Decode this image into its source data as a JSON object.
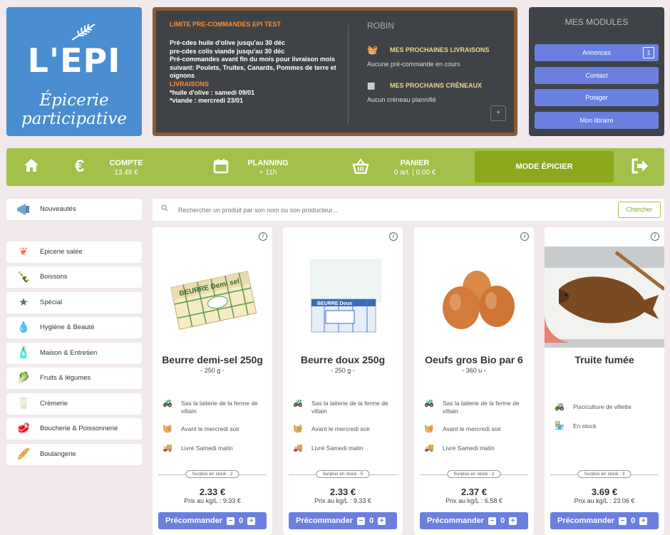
{
  "logo": {
    "title": "L'EPI",
    "subtitle_1": "Épicerie",
    "subtitle_2": "participative"
  },
  "board": {
    "left_title": "LIMITE PRE-COMMANDES EPI TEST",
    "lines": [
      "Pré-cdes huile d'olive jusqu'au 30 déc",
      "pre-cdes colis viande jusqu'au 30 déc",
      "Pré-commandes avant fin du mois pour livraison mois suivant: Poulets, Truites, Canards, Pommes de terre et oignons"
    ],
    "livraisons_label": "LIVRAISONS",
    "livraisons_lines": [
      "*huile d'olive : samedi 09/01",
      "*viande : mercredi 23/01"
    ],
    "user_name": "ROBIN",
    "deliveries_title": "MES PROCHAINES LIVRAISONS",
    "deliveries_text": "Aucune pré-commande en cours",
    "slots_title": "MES PROCHAINS CRÉNEAUX",
    "slots_text": "Aucun créneau plannifié",
    "plus_label": "+"
  },
  "modules": {
    "title": "MES MODULES",
    "items": [
      {
        "label": "Annonces",
        "badge": "1"
      },
      {
        "label": "Contact"
      },
      {
        "label": "Potager"
      },
      {
        "label": "Mon libraire"
      }
    ]
  },
  "nav": {
    "compte_label": "COMPTE",
    "compte_value": "13.48 €",
    "planning_label": "PLANNING",
    "planning_value": "+ 11h",
    "panier_label": "PANIER",
    "panier_value": "0 art. | 0.00 €",
    "mode_label": "MODE ÉPICIER"
  },
  "sidebar": {
    "top": "Nouveautés",
    "items": [
      "Epicerie salée",
      "Boissons",
      "Spécial",
      "Hygiène & Beauté",
      "Maison & Entretien",
      "Fruits & légumes",
      "Crèmerie",
      "Boucherie & Poissonnerie",
      "Boulangerie"
    ]
  },
  "search": {
    "placeholder": "Rechercher un produit par son nom ou son producteur...",
    "button": "Chercher"
  },
  "products": [
    {
      "name": "Beurre demi-sel 250g",
      "qty": "- 250 g -",
      "producer": "Sas la laiterie de la ferme de viltain",
      "availability": "Avant le mercredi soir",
      "delivery": "Livré Samedi matin",
      "stock": "Surplus en stock : 2",
      "price": "2.33 €",
      "kg": "Prix au kg/L : 9.33 €",
      "order": "Précommander",
      "count": "0",
      "box_text": "BEURRE Demi sel"
    },
    {
      "name": "Beurre doux 250g",
      "qty": "- 250 g -",
      "producer": "Sas la laiterie de la ferme de viltain",
      "availability": "Avant le mercredi soir",
      "delivery": "Livré Samedi matin",
      "stock": "Surplus en stock : 5",
      "price": "2.33 €",
      "kg": "Prix au kg/L : 9.33 €",
      "order": "Précommander",
      "count": "0",
      "box_text": "BEURRE Doux"
    },
    {
      "name": "Oeufs gros Bio par 6",
      "qty": "- 360 u -",
      "producer": "Sas la laiterie de la ferme de viltain",
      "availability": "Avant le mercredi soir",
      "delivery": "Livré Samedi matin",
      "stock": "Surplus en stock : 2",
      "price": "2.37 €",
      "kg": "Prix au kg/L : 6.58 €",
      "order": "Précommander",
      "count": "0"
    },
    {
      "name": "Truite fumée",
      "qty": "",
      "producer": "Pisciculture de villette",
      "availability": "En stock",
      "delivery": "",
      "stock": "Surplus en stock : 3",
      "price": "3.69 €",
      "kg": "Prix au kg/L : 23.06 €",
      "order": "Précommander",
      "count": "0"
    }
  ],
  "colors": {
    "green_bar": "#a3c04a",
    "mode_button": "#8ba81d",
    "logo_blue": "#4a8ed1",
    "button_blue": "#6a7fe0",
    "board_dark": "#3f4347",
    "board_frame": "#8b5a36"
  }
}
